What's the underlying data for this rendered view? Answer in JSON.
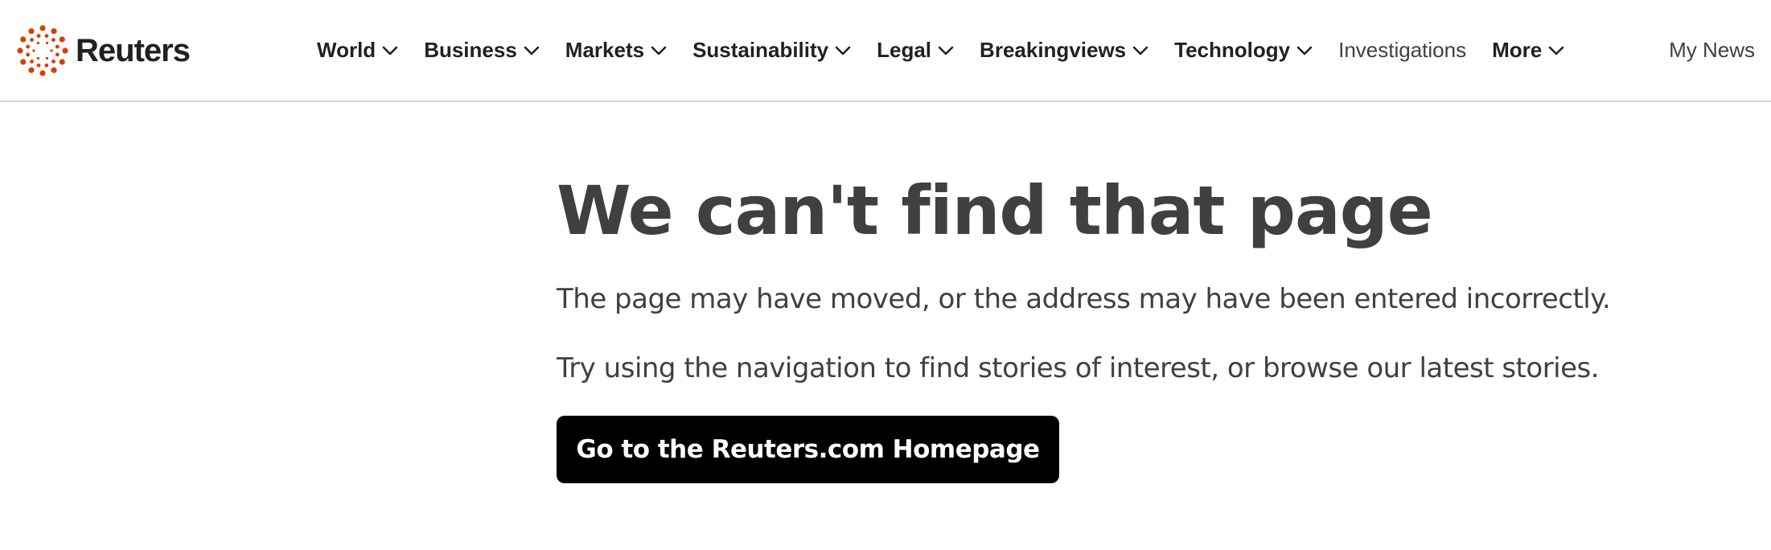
{
  "header": {
    "brand": "Reuters",
    "brand_color": "#d64000",
    "nav_items": [
      {
        "label": "World",
        "has_dropdown": true
      },
      {
        "label": "Business",
        "has_dropdown": true
      },
      {
        "label": "Markets",
        "has_dropdown": true
      },
      {
        "label": "Sustainability",
        "has_dropdown": true
      },
      {
        "label": "Legal",
        "has_dropdown": true
      },
      {
        "label": "Breakingviews",
        "has_dropdown": true
      },
      {
        "label": "Technology",
        "has_dropdown": true
      },
      {
        "label": "Investigations",
        "has_dropdown": false
      },
      {
        "label": "More",
        "has_dropdown": true
      }
    ],
    "my_news": "My News"
  },
  "main": {
    "title": "We can't find that page",
    "paragraph_1": "The page may have moved, or the address may have been entered incorrectly.",
    "paragraph_2": "Try using the navigation to find stories of interest, or browse our latest stories.",
    "home_button": "Go to the Reuters.com Homepage"
  }
}
